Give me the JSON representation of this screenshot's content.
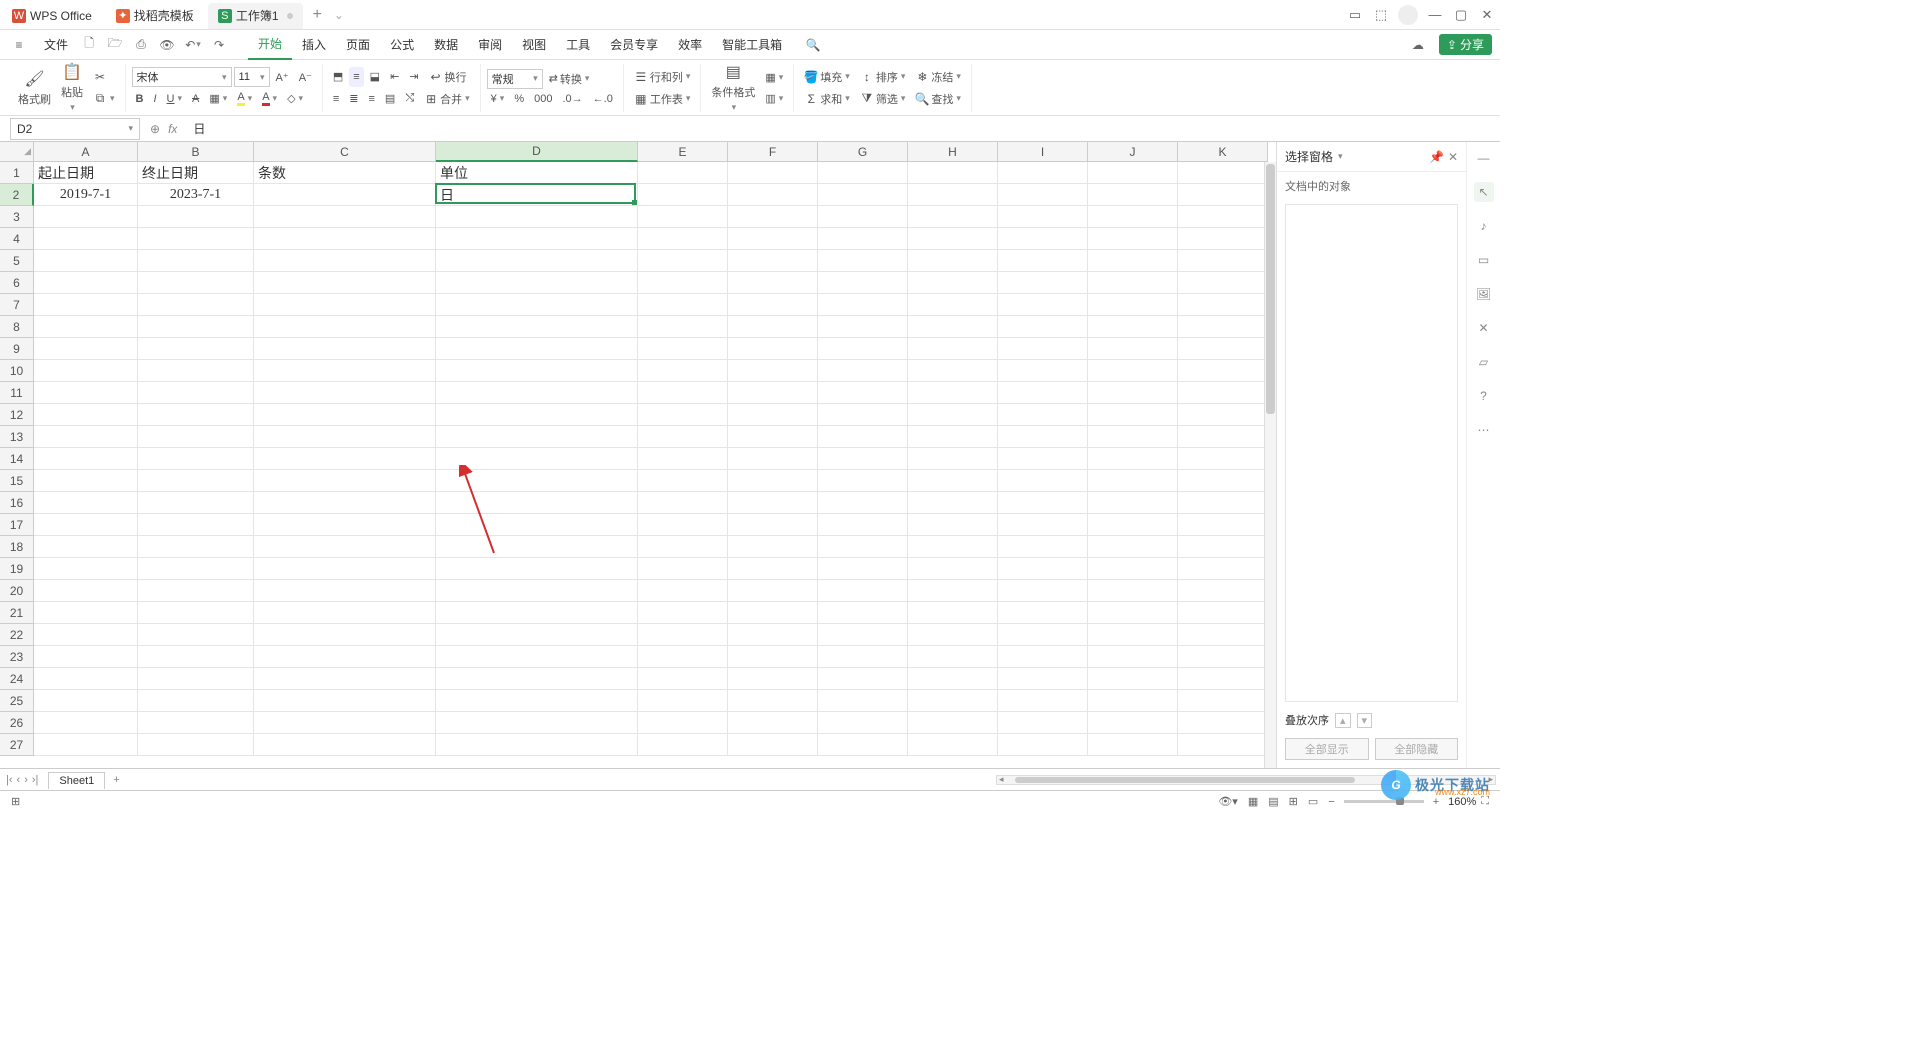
{
  "titlebar": {
    "tabs": [
      {
        "icon": "W",
        "label": "WPS Office"
      },
      {
        "icon": "❃",
        "label": "找稻壳模板"
      },
      {
        "icon": "S",
        "label": "工作簿1"
      }
    ]
  },
  "menubar": {
    "file": "文件",
    "items": [
      "开始",
      "插入",
      "页面",
      "公式",
      "数据",
      "审阅",
      "视图",
      "工具",
      "会员专享",
      "效率",
      "智能工具箱"
    ]
  },
  "share": "分享",
  "ribbon": {
    "format_painter": "格式刷",
    "paste": "粘贴",
    "font_name": "宋体",
    "font_size": "11",
    "bold": "B",
    "italic": "I",
    "underline": "U",
    "strike": "S",
    "wrap": "换行",
    "merge": "合并",
    "number_format": "常规",
    "convert": "转换",
    "row_col": "行和列",
    "worksheet": "工作表",
    "cond_fmt": "条件格式",
    "fill": "填充",
    "sort": "排序",
    "freeze": "冻结",
    "sum": "求和",
    "filter": "筛选",
    "find": "查找"
  },
  "namebox": "D2",
  "formula_content": "日",
  "columns": [
    "A",
    "B",
    "C",
    "D",
    "E",
    "F",
    "G",
    "H",
    "I",
    "J",
    "K"
  ],
  "rows_count": 27,
  "data": {
    "A1": "起止日期",
    "B1": "终止日期",
    "C1": "条数",
    "D1": "单位",
    "A2": "2019-7-1",
    "B2": "2023-7-1",
    "D2": "日"
  },
  "active_col": "D",
  "active_row": 2,
  "rpane": {
    "title": "选择窗格",
    "subtitle": "文档中的对象",
    "stack": "叠放次序",
    "show_all": "全部显示",
    "hide_all": "全部隐藏"
  },
  "sheetbar": {
    "sheet": "Sheet1"
  },
  "status": {
    "zoom": "160%"
  },
  "watermark": {
    "brand": "极光下载站",
    "url": "www.xz7.com"
  }
}
